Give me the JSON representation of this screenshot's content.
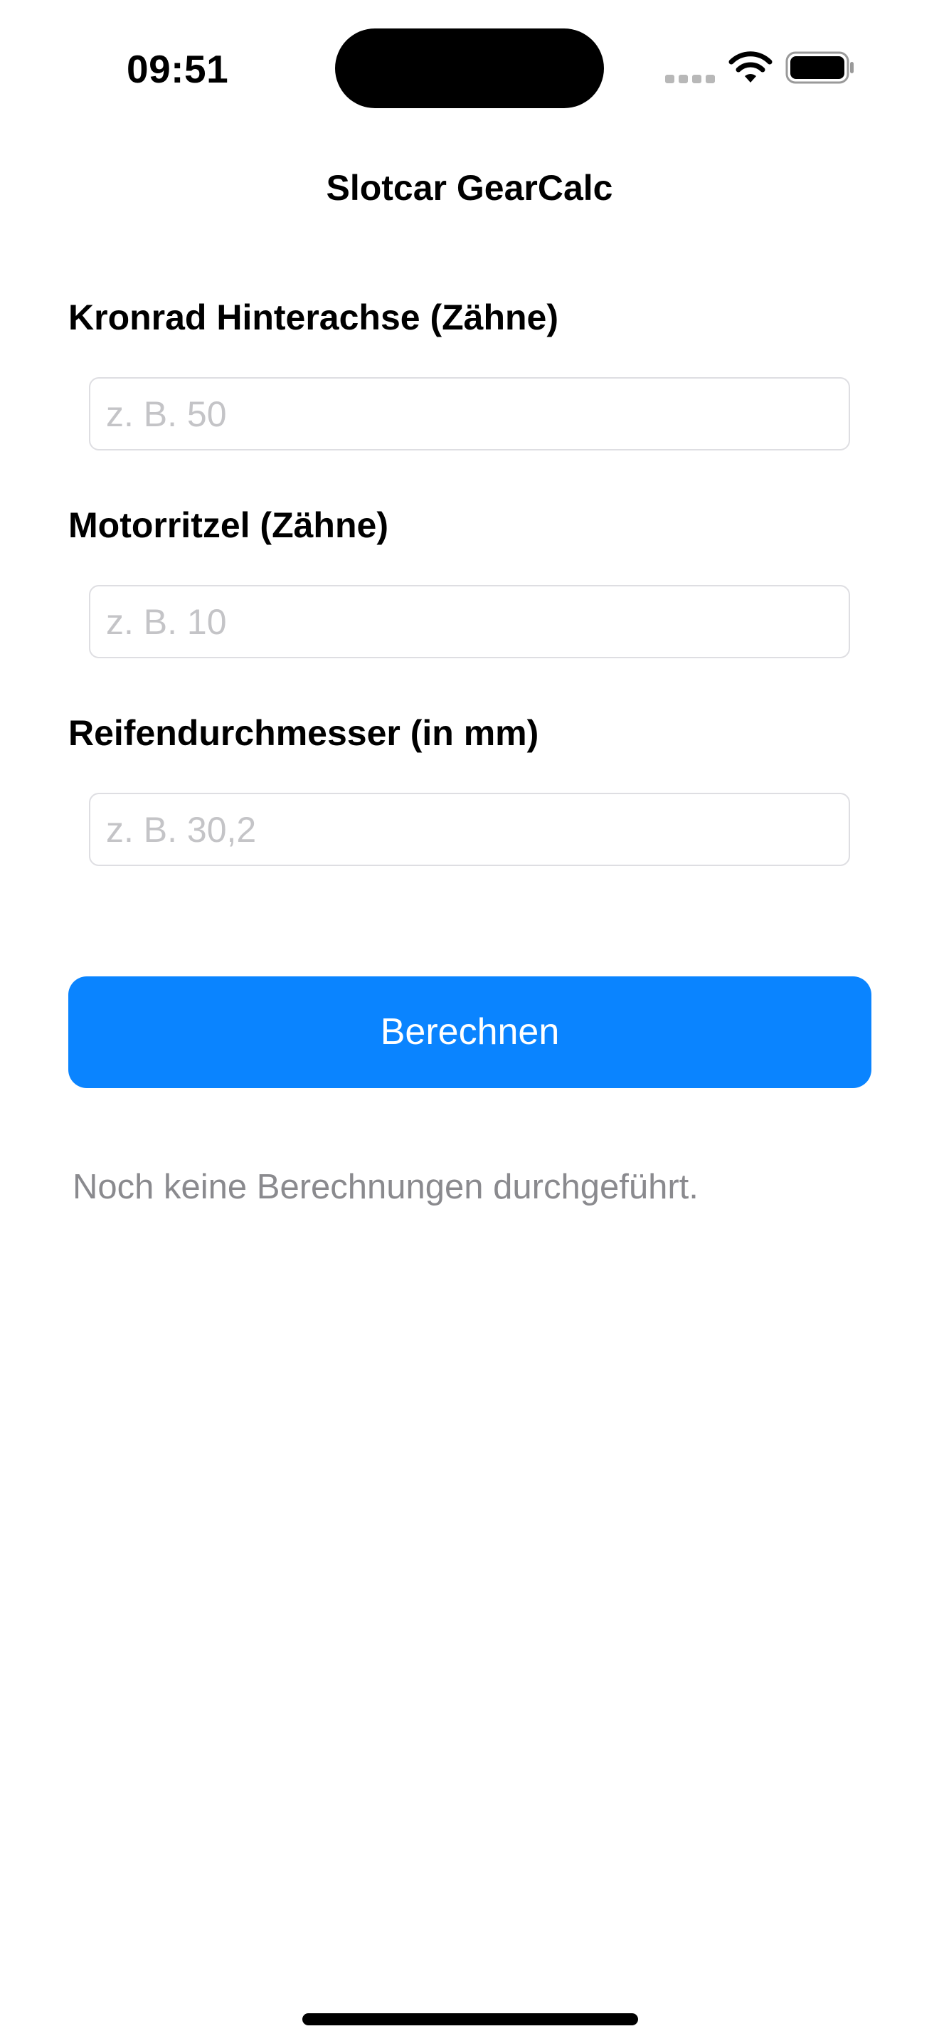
{
  "status_bar": {
    "time": "09:51",
    "icons": [
      "cellular-signal-icon",
      "wifi-icon",
      "battery-icon"
    ]
  },
  "nav": {
    "title": "Slotcar GearCalc"
  },
  "form": {
    "fields": [
      {
        "label": "Kronrad Hinterachse (Zähne)",
        "value": "",
        "placeholder": "z. B. 50"
      },
      {
        "label": "Motorritzel (Zähne)",
        "value": "",
        "placeholder": "z. B. 10"
      },
      {
        "label": "Reifendurchmesser (in mm)",
        "value": "",
        "placeholder": "z. B. 30,2"
      }
    ]
  },
  "actions": {
    "calculate_label": "Berechnen"
  },
  "result": {
    "text": "Noch keine Berechnungen durchgeführt."
  },
  "colors": {
    "accent": "#0a84ff",
    "placeholder": "#c4c4c7",
    "secondary_text": "#8a8a8e",
    "field_border": "#dedee2"
  }
}
